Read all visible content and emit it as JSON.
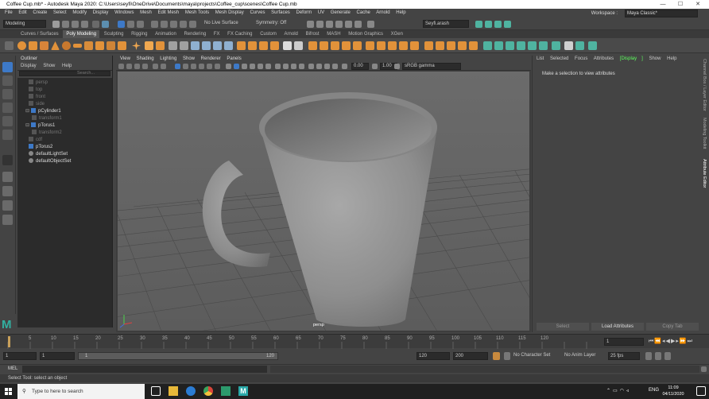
{
  "window": {
    "title": "Coffee Cup.mb* - Autodesk Maya 2020: C:\\Users\\seyfi\\OneDrive\\Documents\\maya\\projects\\Coffee_cup\\scenes\\Coffee Cup.mb",
    "minimize": "—",
    "maximize": "☐",
    "close": "✕"
  },
  "menubar": {
    "items": [
      "File",
      "Edit",
      "Create",
      "Select",
      "Modify",
      "Display",
      "Windows",
      "Mesh",
      "Edit Mesh",
      "Mesh Tools",
      "Mesh Display",
      "Curves",
      "Surfaces",
      "Deform",
      "UV",
      "Generate",
      "Cache",
      "Arnold",
      "Help"
    ],
    "workspace_label": "Workspace :",
    "workspace_value": "Maya Classic*"
  },
  "statusline": {
    "mode": "Modeling",
    "live_surface": "No Live Surface",
    "symmetry": "Symmetry: Off",
    "user": "Seyfi.arash"
  },
  "shelf_tabs": {
    "items": [
      "Curves / Surfaces",
      "Poly Modeling",
      "Sculpting",
      "Rigging",
      "Animation",
      "Rendering",
      "FX",
      "FX Caching",
      "Custom",
      "Arnold",
      "Bifrost",
      "MASH",
      "Motion Graphics",
      "XGen"
    ],
    "active_index": 1
  },
  "outliner": {
    "title": "Outliner",
    "menu": [
      "Display",
      "Show",
      "Help"
    ],
    "search_placeholder": "Search...",
    "items": [
      {
        "label": "persp",
        "dim": true,
        "indent": 1
      },
      {
        "label": "top",
        "dim": true,
        "indent": 1
      },
      {
        "label": "front",
        "dim": true,
        "indent": 1
      },
      {
        "label": "side",
        "dim": true,
        "indent": 1
      },
      {
        "label": "pCylinder1",
        "dim": false,
        "indent": 0
      },
      {
        "label": "transform1",
        "dim": true,
        "indent": 2
      },
      {
        "label": "pTorus1",
        "dim": false,
        "indent": 0
      },
      {
        "label": "transform2",
        "dim": true,
        "indent": 2
      },
      {
        "label": "cdf",
        "dim": true,
        "indent": 1
      },
      {
        "label": "pTorus2",
        "dim": false,
        "indent": 1
      },
      {
        "label": "defaultLightSet",
        "dim": false,
        "indent": 1
      },
      {
        "label": "defaultObjectSet",
        "dim": false,
        "indent": 1
      }
    ]
  },
  "viewport": {
    "menu": [
      "View",
      "Shading",
      "Lighting",
      "Show",
      "Renderer",
      "Panels"
    ],
    "exposure": "0.00",
    "gamma": "1.00",
    "color_space": "sRGB gamma",
    "camera_label": "persp"
  },
  "attribute_editor": {
    "menu": [
      "List",
      "Selected",
      "Focus",
      "Attributes",
      "Display",
      "Show",
      "Help"
    ],
    "highlight_index": 4,
    "message": "Make a selection to view attributes",
    "buttons": [
      "Select",
      "Load Attributes",
      "Copy Tab"
    ]
  },
  "side_tabs": [
    "Channel Box / Layer Editor",
    "Modeling Toolkit",
    "Attribute Editor"
  ],
  "timeslider": {
    "ticks": [
      "5",
      "10",
      "15",
      "20",
      "25",
      "30",
      "35",
      "40",
      "45",
      "50",
      "55",
      "60",
      "65",
      "70",
      "75",
      "80",
      "85",
      "90",
      "95",
      "100",
      "105",
      "110",
      "115",
      "120"
    ],
    "current_frame": "1"
  },
  "range": {
    "start": "1",
    "playback_start": "1",
    "slider_start": "1",
    "slider_end": "120",
    "playback_end": "120",
    "end": "200",
    "character_set": "No Character Set",
    "anim_layer": "No Anim Layer",
    "fps": "25 fps"
  },
  "cmdline": {
    "label": "MEL"
  },
  "helpline": {
    "text": "Select Tool: select an object"
  },
  "taskbar": {
    "search_placeholder": "Type to here to search",
    "time": "11:09",
    "date": "04/11/2020",
    "lang": "ENG"
  },
  "colors": {
    "maya_bg": "#444444",
    "dark_panel": "#2b2b2b",
    "shelf_orange": "#e2923a",
    "shelf_green": "#4fb3a0",
    "attr_highlight": "#5eff5e",
    "playhead": "#c8a05a",
    "taskbar": "#202020"
  }
}
